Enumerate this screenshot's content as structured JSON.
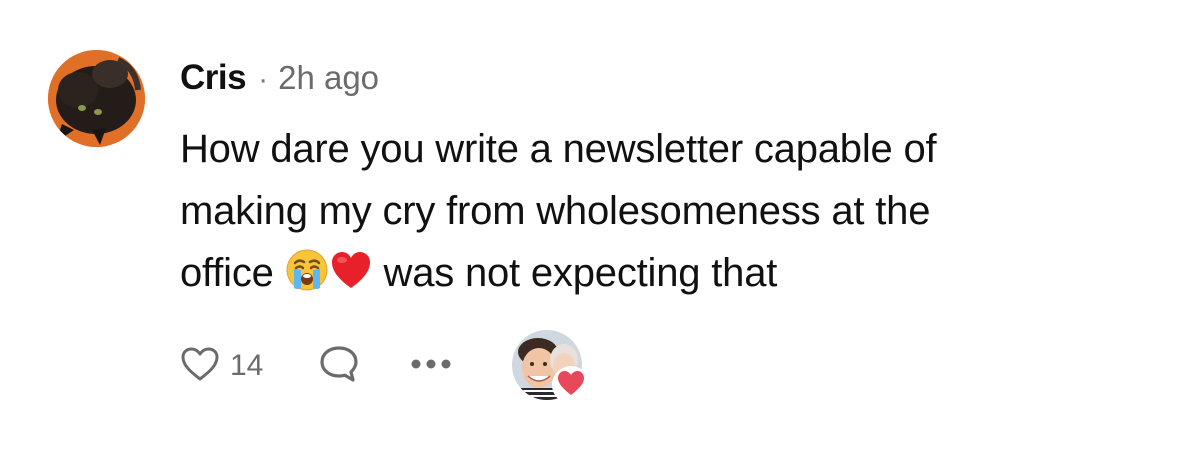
{
  "comment": {
    "author": "Cris",
    "separator": "·",
    "time": "2h ago",
    "text_line1": "How dare you write a newsletter capable of",
    "text_line2": "making my cry from wholesomeness at the",
    "text_line3_before": "office ",
    "text_line3_after": " was not expecting that",
    "emojis": [
      "crying-face",
      "red-heart"
    ]
  },
  "actions": {
    "like_count": "14",
    "icons": [
      "heart-outline-icon",
      "speech-bubble-icon",
      "more-dots-icon"
    ]
  },
  "colors": {
    "text": "#111111",
    "muted": "#6b6b6b",
    "heart_red": "#e8485a"
  }
}
